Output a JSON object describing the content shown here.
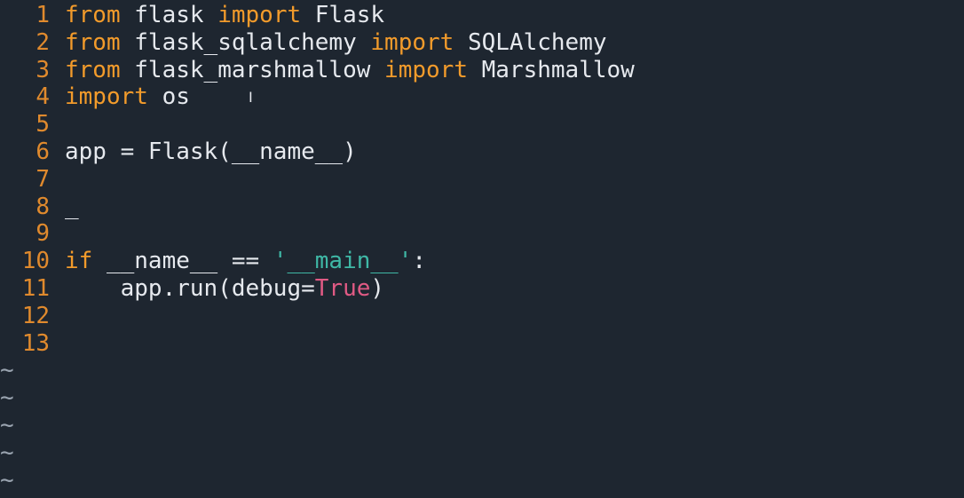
{
  "editor": {
    "lines": [
      {
        "num": "1",
        "tokens": [
          {
            "t": "from",
            "c": "kw"
          },
          {
            "t": " flask ",
            "c": ""
          },
          {
            "t": "import",
            "c": "kw"
          },
          {
            "t": " Flask",
            "c": ""
          }
        ]
      },
      {
        "num": "2",
        "tokens": [
          {
            "t": "from",
            "c": "kw"
          },
          {
            "t": " flask_sqlalchemy ",
            "c": ""
          },
          {
            "t": "import",
            "c": "kw"
          },
          {
            "t": " SQLAlchemy",
            "c": ""
          }
        ]
      },
      {
        "num": "3",
        "tokens": [
          {
            "t": "from",
            "c": "kw"
          },
          {
            "t": " flask_marshmallow ",
            "c": ""
          },
          {
            "t": "import",
            "c": "kw"
          },
          {
            "t": " Marshmallow",
            "c": ""
          }
        ]
      },
      {
        "num": "4",
        "tokens": [
          {
            "t": "import",
            "c": "kw"
          },
          {
            "t": " os",
            "c": ""
          }
        ]
      },
      {
        "num": "5",
        "tokens": []
      },
      {
        "num": "6",
        "tokens": [
          {
            "t": "app = Flask(__name__)",
            "c": ""
          }
        ]
      },
      {
        "num": "7",
        "tokens": []
      },
      {
        "num": "8",
        "tokens": [
          {
            "t": "_",
            "c": ""
          }
        ]
      },
      {
        "num": "9",
        "tokens": []
      },
      {
        "num": "10",
        "tokens": [
          {
            "t": "if",
            "c": "kw"
          },
          {
            "t": " __name__ == ",
            "c": ""
          },
          {
            "t": "'__main__'",
            "c": "str"
          },
          {
            "t": ":",
            "c": ""
          }
        ]
      },
      {
        "num": "11",
        "tokens": [
          {
            "t": "    app.run(debug=",
            "c": ""
          },
          {
            "t": "True",
            "c": "bool"
          },
          {
            "t": ")",
            "c": ""
          }
        ]
      },
      {
        "num": "12",
        "tokens": []
      },
      {
        "num": "13",
        "tokens": []
      }
    ],
    "empty_marker": "~",
    "empty_marker_count": 5,
    "cursor_glyph": "I"
  },
  "colors": {
    "background": "#1e2630",
    "line_number": "#e08a2d",
    "keyword": "#f29b2b",
    "string": "#3fb8a6",
    "boolean": "#e05a84",
    "text": "#e6e9ee",
    "tilde": "#9aa4b0"
  }
}
